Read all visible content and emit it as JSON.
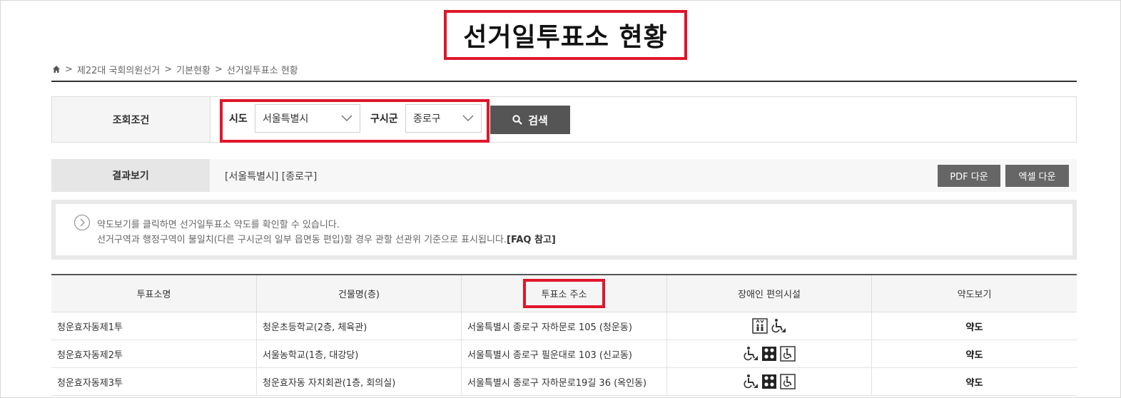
{
  "page": {
    "title": "선거일투표소 현황"
  },
  "breadcrumb": {
    "home_icon": "home-icon",
    "items": [
      "제22대 국회의원선거",
      "기본현황",
      "선거일투표소 현황"
    ],
    "separator": ">"
  },
  "search": {
    "label": "조회조건",
    "sido_label": "시도",
    "sido_value": "서울특별시",
    "sigungu_label": "구시군",
    "sigungu_value": "종로구",
    "search_button": "검색"
  },
  "result": {
    "label": "결과보기",
    "summary": "[서울특별시]  [종로구]",
    "pdf_button": "PDF 다운",
    "excel_button": "엑셀 다운"
  },
  "notice": {
    "line1": "약도보기를 클릭하면 선거일투표소 약도를 확인할 수 있습니다.",
    "line2": "선거구역과 행정구역이 불일치(다른 구시군의 일부 읍면동 편입)할 경우 관할 선관위 기준으로 표시됩니다.",
    "line2_link": "[FAQ 참고]"
  },
  "table": {
    "headers": [
      "투표소명",
      "건물명(층)",
      "투표소 주소",
      "장애인 편의시설",
      "약도보기"
    ],
    "rows": [
      {
        "name": "청운효자동제1투",
        "building": "청운초등학교(2층, 체육관)",
        "address": "서울특별시 종로구 자하문로 105 (청운동)",
        "facilities": [
          "elevator-icon",
          "wheelchair-ramp-icon"
        ],
        "map": "약도"
      },
      {
        "name": "청운효자동제2투",
        "building": "서울농학교(1층, 대강당)",
        "address": "서울특별시 종로구 필운대로 103 (신교동)",
        "facilities": [
          "wheelchair-ramp-icon",
          "braille-icon",
          "accessible-icon"
        ],
        "map": "약도"
      },
      {
        "name": "청운효자동제3투",
        "building": "청운효자동 자치회관(1층, 회의실)",
        "address": "서울특별시 종로구 자하문로19길 36 (옥인동)",
        "facilities": [
          "wheelchair-ramp-icon",
          "braille-icon",
          "accessible-icon"
        ],
        "map": "약도"
      }
    ]
  },
  "colors": {
    "highlight": "#e0162b",
    "button_dark": "#555555",
    "button_gray": "#666666"
  }
}
